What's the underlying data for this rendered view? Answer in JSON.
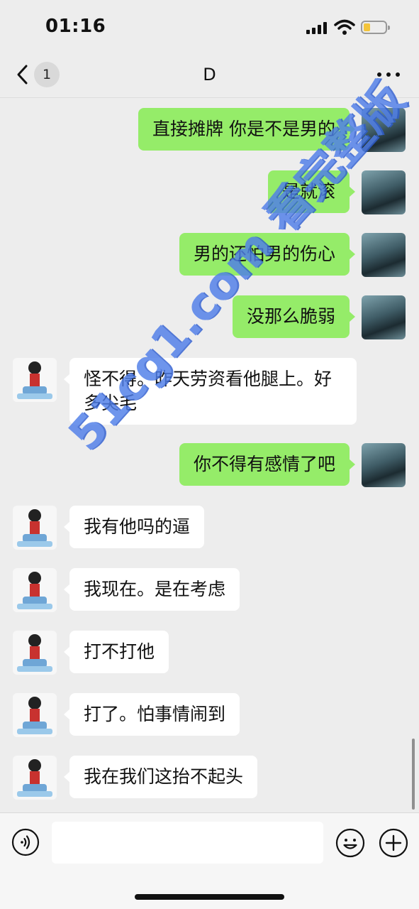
{
  "status_bar": {
    "time": "01:16"
  },
  "nav": {
    "back_badge": "1",
    "title": "D"
  },
  "messages": [
    {
      "from": "me",
      "text": "直接摊牌 你是不是男的"
    },
    {
      "from": "me",
      "text": "是就滚"
    },
    {
      "from": "me",
      "text": "男的还怕男的伤心"
    },
    {
      "from": "me",
      "text": "没那么脆弱"
    },
    {
      "from": "them",
      "text": "怪不得。昨天劳资看他腿上。好多尖毛"
    },
    {
      "from": "me",
      "text": "你不得有感情了吧"
    },
    {
      "from": "them",
      "text": "我有他吗的逼"
    },
    {
      "from": "them",
      "text": "我现在。是在考虑"
    },
    {
      "from": "them",
      "text": "打不打他"
    },
    {
      "from": "them",
      "text": "打了。怕事情闹到"
    },
    {
      "from": "them",
      "text": "我在我们这抬不起头"
    }
  ],
  "watermark": "51cg1.com 看完整版",
  "input": {
    "value": ""
  },
  "icons": {
    "back": "chevron-left-icon",
    "more": "more-dots-icon",
    "voice": "voice-icon",
    "emoji": "emoji-icon",
    "plus": "plus-icon"
  },
  "colors": {
    "my_bubble": "#95ec69",
    "their_bubble": "#ffffff",
    "background": "#ededed",
    "watermark": "#4f7ee9"
  }
}
